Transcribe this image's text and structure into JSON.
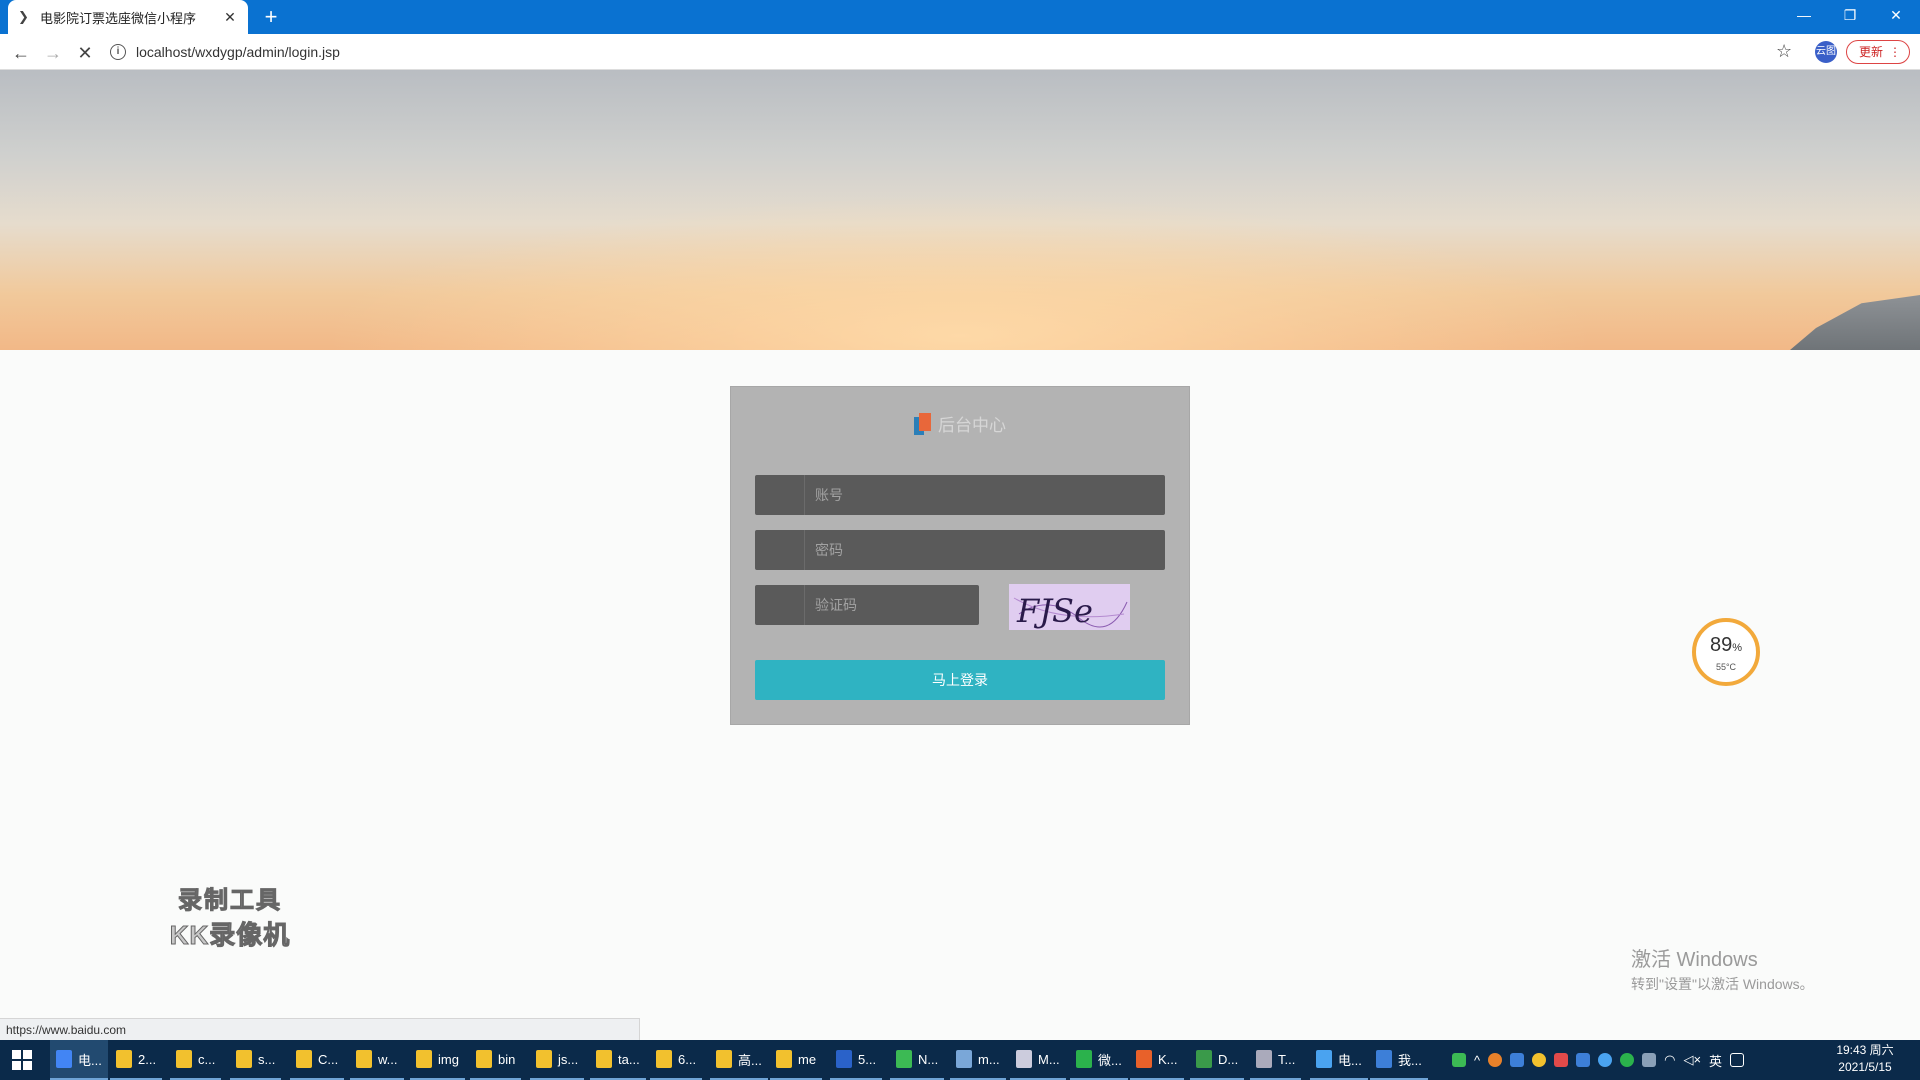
{
  "browser": {
    "tab_title": "电影院订票选座微信小程序",
    "url": "localhost/wxdygp/admin/login.jsp",
    "avatar_text": "云图",
    "update_label": "更新",
    "status_url": "https://www.baidu.com"
  },
  "login": {
    "title": "后台中心",
    "username_placeholder": "账号",
    "password_placeholder": "密码",
    "captcha_placeholder": "验证码",
    "captcha_text": "FJSe",
    "submit_label": "马上登录"
  },
  "overlay": {
    "gauge_percent": "89",
    "gauge_unit": "%",
    "gauge_temp": "55°C",
    "watermark_line1": "录制工具",
    "watermark_line2": "KK录像机",
    "activate_title": "激活 Windows",
    "activate_sub": "转到\"设置\"以激活 Windows。"
  },
  "taskbar": {
    "items": [
      "电...",
      "2...",
      "c...",
      "s...",
      "C...",
      "w...",
      "img",
      "bin",
      "js...",
      "ta...",
      "6...",
      "高...",
      "me",
      "5...",
      "N...",
      "m...",
      "M...",
      "微...",
      "K...",
      "D...",
      "T...",
      "电...",
      "我..."
    ],
    "ime": "英",
    "time": "19:43 周六",
    "date": "2021/5/15"
  }
}
